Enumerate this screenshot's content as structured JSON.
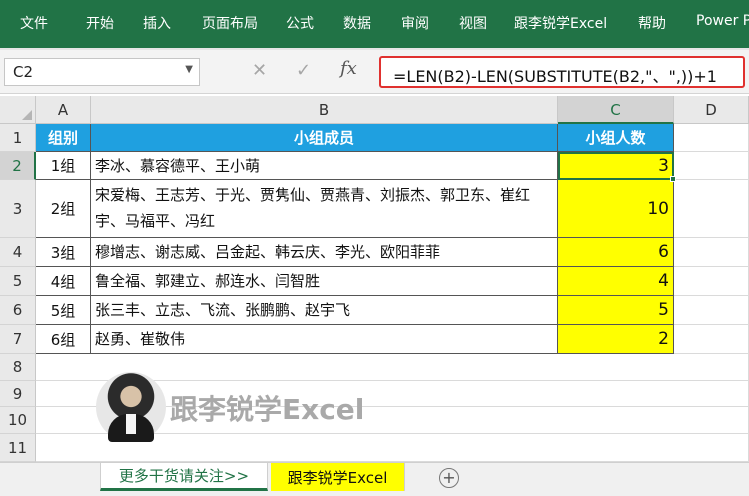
{
  "ribbon": {
    "tabs": [
      "文件",
      "开始",
      "插入",
      "页面布局",
      "公式",
      "数据",
      "审阅",
      "视图",
      "跟李锐学Excel",
      "帮助",
      "Power P"
    ]
  },
  "formula_bar": {
    "name_box": "C2",
    "cancel_glyph": "✕",
    "enter_glyph": "✓",
    "fx_label": "fx",
    "formula": "=LEN(B2)-LEN(SUBSTITUTE(B2,\"、\",))+1"
  },
  "columns": [
    "A",
    "B",
    "C",
    "D"
  ],
  "rows": [
    "1",
    "2",
    "3",
    "4",
    "5",
    "6",
    "7",
    "8",
    "9",
    "10",
    "11"
  ],
  "table": {
    "headers": [
      "组别",
      "小组成员",
      "小组人数"
    ],
    "data": [
      {
        "group": "1组",
        "members": "李冰、慕容德平、王小萌",
        "count": "3"
      },
      {
        "group": "2组",
        "members": "宋爱梅、王志芳、于光、贾隽仙、贾燕青、刘振杰、郭卫东、崔红宇、马福平、冯红",
        "count": "10"
      },
      {
        "group": "3组",
        "members": "穆增志、谢志威、吕金起、韩云庆、李光、欧阳菲菲",
        "count": "6"
      },
      {
        "group": "4组",
        "members": "鲁全福、郭建立、郝连水、闫智胜",
        "count": "4"
      },
      {
        "group": "5组",
        "members": "张三丰、立志、飞流、张鹏鹏、赵宇飞",
        "count": "5"
      },
      {
        "group": "6组",
        "members": "赵勇、崔敬伟",
        "count": "2"
      }
    ]
  },
  "watermark": {
    "text": "跟李锐学Excel"
  },
  "sheet_tabs": [
    "更多干货请关注>>",
    "跟李锐学Excel"
  ],
  "colors": {
    "ribbon": "#217346",
    "header_fill": "#1fa0e0",
    "count_fill": "#ffff00",
    "formula_border": "#e0312f"
  }
}
